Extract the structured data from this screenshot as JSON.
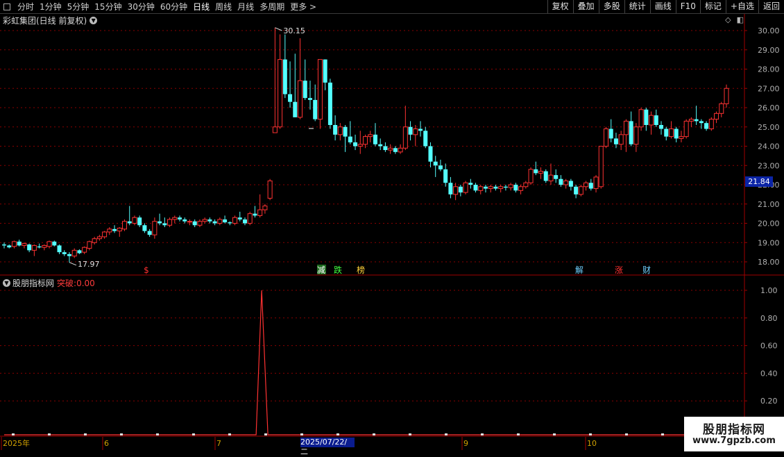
{
  "toolbar": {
    "left_items": [
      "分时",
      "1分钟",
      "5分钟",
      "15分钟",
      "30分钟",
      "60分钟",
      "日线",
      "周线",
      "月线",
      "多周期",
      "更多 >"
    ],
    "active": "日线",
    "right_items": [
      "复权",
      "叠加",
      "多股",
      "统计",
      "画线",
      "F10",
      "标记",
      "+自选",
      "返回"
    ]
  },
  "main_chart": {
    "title": "彩虹集团(日线 前复权)",
    "y_ticks": [
      "30.00",
      "29.00",
      "28.00",
      "27.00",
      "26.00",
      "25.00",
      "24.00",
      "23.00",
      "22.00",
      "21.00",
      "20.00",
      "19.00",
      "18.00"
    ],
    "current_price": "21.84",
    "high_label": "30.15",
    "low_label": "17.97",
    "markers": [
      {
        "text": "$",
        "color": "#ff3030"
      },
      {
        "text": "减",
        "color": "#ffffff",
        "bg": "#1e6b1e"
      },
      {
        "text": "跌",
        "color": "#40ff40"
      },
      {
        "text": "榜",
        "color": "#ffd23a"
      },
      {
        "text": "解",
        "color": "#6fd0ff"
      },
      {
        "text": "涨",
        "color": "#ff3030"
      },
      {
        "text": "财",
        "color": "#6fd0ff"
      }
    ]
  },
  "indicator": {
    "name": "股朋指标网",
    "series_label": "突破",
    "series_value": "0.00",
    "y_ticks": [
      "1.00",
      "0.80",
      "0.60",
      "0.40",
      "0.20"
    ]
  },
  "x_axis": {
    "labels": [
      "2025年",
      "6",
      "7",
      "9",
      "10"
    ],
    "selected_date": "2025/07/22/二"
  },
  "watermark": {
    "title": "股朋指标网",
    "url": "www.7gpzb.com"
  },
  "chart_data": {
    "type": "candlestick",
    "title": "彩虹集团(日线 前复权)",
    "ylim": [
      17.6,
      30.4
    ],
    "candles": [
      [
        18.9,
        19.0,
        18.7,
        18.85
      ],
      [
        18.85,
        18.9,
        18.7,
        18.75
      ],
      [
        18.8,
        19.1,
        18.7,
        19.05
      ],
      [
        19.05,
        19.15,
        18.8,
        18.85
      ],
      [
        18.85,
        19.0,
        18.7,
        18.95
      ],
      [
        18.9,
        18.95,
        18.5,
        18.6
      ],
      [
        18.6,
        18.9,
        18.3,
        18.85
      ],
      [
        18.8,
        18.95,
        18.7,
        18.75
      ],
      [
        18.75,
        18.9,
        18.6,
        18.85
      ],
      [
        18.8,
        19.1,
        18.7,
        19.05
      ],
      [
        19.05,
        19.1,
        18.8,
        18.85
      ],
      [
        18.85,
        18.9,
        18.4,
        18.5
      ],
      [
        18.5,
        18.6,
        18.3,
        18.4
      ],
      [
        18.4,
        18.5,
        17.97,
        18.3
      ],
      [
        18.3,
        18.7,
        18.2,
        18.6
      ],
      [
        18.6,
        18.65,
        18.4,
        18.45
      ],
      [
        18.5,
        18.8,
        18.4,
        18.75
      ],
      [
        18.7,
        19.1,
        18.6,
        19.05
      ],
      [
        19.0,
        19.3,
        18.9,
        19.2
      ],
      [
        19.2,
        19.4,
        19.1,
        19.3
      ],
      [
        19.3,
        19.6,
        19.2,
        19.55
      ],
      [
        19.55,
        19.8,
        19.4,
        19.7
      ],
      [
        19.7,
        19.9,
        19.5,
        19.6
      ],
      [
        19.6,
        19.8,
        19.3,
        19.75
      ],
      [
        19.7,
        20.2,
        19.6,
        20.1
      ],
      [
        20.1,
        20.9,
        19.9,
        20.0
      ],
      [
        20.0,
        20.4,
        19.9,
        20.3
      ],
      [
        20.3,
        20.4,
        19.8,
        19.9
      ],
      [
        19.9,
        20.0,
        19.5,
        19.6
      ],
      [
        19.6,
        19.7,
        19.3,
        19.4
      ],
      [
        19.4,
        20.3,
        19.2,
        20.1
      ],
      [
        20.1,
        20.5,
        19.9,
        20.0
      ],
      [
        20.0,
        20.3,
        19.8,
        19.9
      ],
      [
        19.9,
        20.3,
        19.8,
        20.2
      ],
      [
        20.2,
        20.4,
        20.0,
        20.3
      ],
      [
        20.3,
        20.4,
        20.1,
        20.2
      ],
      [
        20.2,
        20.3,
        20.0,
        20.1
      ],
      [
        20.1,
        20.2,
        19.9,
        20.1
      ],
      [
        20.1,
        20.2,
        19.8,
        19.9
      ],
      [
        19.9,
        20.2,
        19.8,
        20.1
      ],
      [
        20.1,
        20.3,
        20.0,
        20.2
      ],
      [
        20.2,
        20.3,
        20.0,
        20.1
      ],
      [
        20.1,
        20.2,
        19.9,
        20.0
      ],
      [
        20.0,
        20.3,
        19.9,
        20.2
      ],
      [
        20.2,
        20.4,
        20.0,
        20.05
      ],
      [
        20.05,
        20.1,
        19.9,
        20.0
      ],
      [
        20.0,
        20.4,
        19.9,
        20.3
      ],
      [
        20.3,
        20.6,
        20.1,
        20.2
      ],
      [
        20.2,
        20.3,
        19.9,
        20.0
      ],
      [
        20.0,
        20.6,
        19.9,
        20.5
      ],
      [
        20.5,
        20.9,
        20.3,
        20.4
      ],
      [
        20.4,
        21.5,
        20.3,
        20.7
      ],
      [
        20.7,
        21.0,
        20.5,
        20.9
      ],
      [
        21.3,
        22.3,
        21.2,
        22.2
      ],
      [
        24.7,
        30.15,
        24.7,
        25.0
      ],
      [
        25.0,
        29.8,
        24.9,
        28.5
      ],
      [
        28.5,
        29.8,
        26.5,
        26.7
      ],
      [
        26.7,
        28.4,
        26.0,
        26.3
      ],
      [
        26.3,
        28.8,
        25.9,
        25.5
      ],
      [
        25.5,
        29.6,
        25.4,
        27.4
      ],
      [
        27.4,
        28.5,
        26.4,
        26.5
      ],
      [
        26.5,
        27.4,
        25.9,
        26.4
      ],
      [
        26.4,
        27.2,
        25.3,
        25.4
      ],
      [
        25.4,
        28.5,
        24.9,
        28.5
      ],
      [
        28.5,
        28.5,
        26.9,
        27.3
      ],
      [
        27.3,
        27.5,
        24.9,
        25.1
      ],
      [
        25.1,
        25.6,
        24.3,
        24.6
      ],
      [
        24.6,
        25.2,
        24.3,
        25.0
      ],
      [
        25.0,
        25.1,
        23.7,
        24.5
      ],
      [
        24.5,
        25.3,
        24.1,
        24.2
      ],
      [
        24.2,
        24.6,
        23.8,
        24.0
      ],
      [
        24.0,
        24.8,
        23.6,
        24.1
      ],
      [
        24.1,
        24.6,
        23.9,
        24.5
      ],
      [
        24.5,
        24.8,
        24.2,
        24.6
      ],
      [
        24.6,
        25.2,
        24.0,
        24.1
      ],
      [
        24.1,
        24.4,
        23.8,
        24.0
      ],
      [
        24.0,
        24.2,
        23.7,
        23.8
      ],
      [
        23.8,
        24.1,
        23.6,
        23.9
      ],
      [
        23.9,
        24.0,
        23.6,
        23.7
      ],
      [
        23.7,
        24.1,
        23.6,
        23.9
      ],
      [
        23.9,
        26.1,
        23.8,
        25.0
      ],
      [
        25.0,
        25.3,
        24.3,
        24.6
      ],
      [
        24.6,
        25.1,
        24.0,
        24.9
      ],
      [
        24.9,
        25.3,
        24.5,
        24.8
      ],
      [
        24.8,
        25.0,
        23.9,
        24.0
      ],
      [
        24.0,
        24.2,
        22.9,
        23.2
      ],
      [
        23.2,
        23.5,
        22.4,
        23.0
      ],
      [
        23.0,
        23.3,
        22.7,
        22.8
      ],
      [
        22.8,
        23.1,
        21.9,
        22.1
      ],
      [
        22.1,
        22.4,
        21.3,
        21.5
      ],
      [
        21.5,
        22.1,
        21.2,
        21.9
      ],
      [
        21.9,
        22.0,
        21.4,
        21.6
      ],
      [
        21.6,
        22.2,
        21.5,
        22.1
      ],
      [
        22.1,
        22.3,
        21.8,
        22.0
      ],
      [
        22.0,
        22.1,
        21.6,
        21.7
      ],
      [
        21.7,
        22.0,
        21.5,
        21.9
      ],
      [
        21.9,
        22.0,
        21.6,
        21.8
      ],
      [
        21.8,
        22.0,
        21.6,
        21.9
      ],
      [
        21.9,
        22.0,
        21.7,
        21.8
      ],
      [
        21.8,
        22.0,
        21.6,
        21.9
      ],
      [
        21.9,
        22.0,
        21.7,
        21.85
      ],
      [
        21.85,
        22.1,
        21.7,
        22.0
      ],
      [
        22.0,
        22.1,
        21.6,
        21.7
      ],
      [
        21.7,
        22.0,
        21.5,
        21.9
      ],
      [
        21.9,
        22.2,
        21.8,
        22.1
      ],
      [
        22.1,
        22.9,
        22.0,
        22.8
      ],
      [
        22.8,
        23.2,
        22.5,
        22.6
      ],
      [
        22.6,
        22.9,
        22.3,
        22.7
      ],
      [
        22.7,
        22.8,
        22.1,
        22.2
      ],
      [
        22.2,
        23.1,
        22.0,
        22.5
      ],
      [
        22.5,
        22.8,
        22.1,
        22.3
      ],
      [
        22.3,
        22.5,
        21.9,
        22.0
      ],
      [
        22.0,
        22.3,
        21.8,
        22.2
      ],
      [
        22.2,
        22.3,
        21.7,
        21.9
      ],
      [
        21.9,
        22.0,
        21.3,
        21.5
      ],
      [
        21.5,
        22.0,
        21.4,
        21.9
      ],
      [
        21.9,
        22.2,
        21.7,
        22.1
      ],
      [
        22.1,
        22.3,
        21.7,
        21.8
      ],
      [
        21.8,
        22.5,
        21.6,
        22.4
      ],
      [
        21.9,
        24.0,
        21.8,
        24.0
      ],
      [
        24.0,
        25.0,
        23.9,
        24.9
      ],
      [
        24.9,
        25.4,
        24.2,
        24.4
      ],
      [
        24.4,
        24.7,
        23.9,
        24.1
      ],
      [
        24.1,
        24.8,
        23.8,
        24.6
      ],
      [
        24.6,
        25.4,
        23.7,
        25.3
      ],
      [
        25.3,
        25.8,
        24.0,
        24.1
      ],
      [
        24.1,
        25.2,
        23.7,
        25.0
      ],
      [
        25.0,
        26.0,
        24.8,
        25.9
      ],
      [
        25.9,
        26.0,
        24.8,
        25.1
      ],
      [
        25.1,
        25.8,
        24.6,
        25.6
      ],
      [
        25.6,
        25.9,
        25.0,
        25.1
      ],
      [
        25.1,
        25.3,
        24.6,
        24.9
      ],
      [
        24.9,
        25.0,
        24.3,
        24.5
      ],
      [
        24.5,
        25.3,
        24.4,
        24.9
      ],
      [
        24.9,
        25.0,
        24.2,
        24.4
      ],
      [
        24.4,
        24.8,
        24.2,
        24.5
      ],
      [
        24.5,
        25.4,
        24.4,
        25.3
      ],
      [
        25.3,
        25.5,
        25.0,
        25.4
      ],
      [
        25.4,
        26.1,
        25.1,
        25.3
      ],
      [
        25.3,
        25.4,
        24.9,
        25.2
      ],
      [
        25.2,
        25.3,
        24.8,
        24.9
      ],
      [
        24.9,
        25.5,
        24.8,
        25.4
      ],
      [
        25.4,
        25.8,
        25.2,
        25.7
      ],
      [
        25.7,
        26.3,
        25.5,
        26.2
      ],
      [
        26.2,
        27.2,
        26.0,
        27.0
      ]
    ],
    "indicator_series": {
      "name": "突破",
      "spike_index": 53,
      "spike_value": 1.0
    }
  }
}
